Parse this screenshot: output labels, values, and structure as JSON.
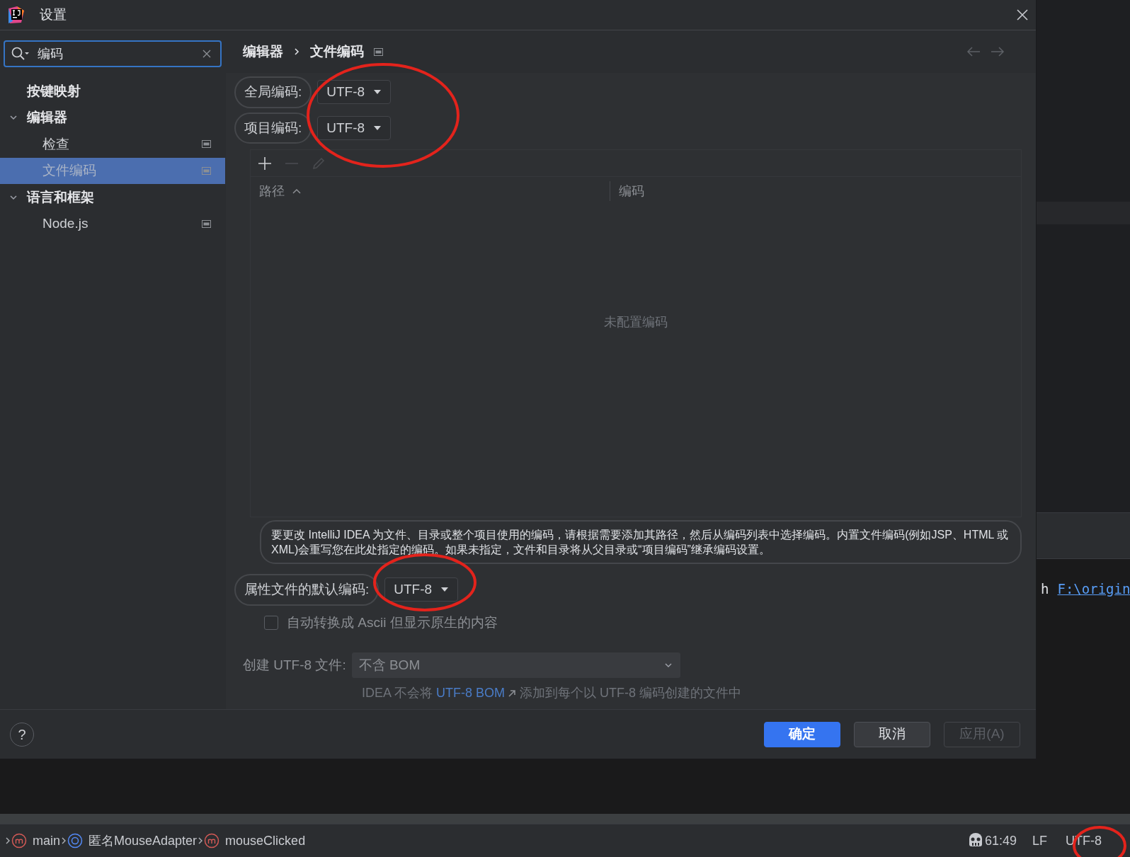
{
  "window": {
    "title": "设置"
  },
  "search": {
    "value": "编码"
  },
  "sidebar": {
    "items": [
      {
        "label": "按键映射",
        "selected": false
      },
      {
        "label": "编辑器",
        "selected": false,
        "expanded": true,
        "children": [
          {
            "label": "检查",
            "selected": false
          },
          {
            "label": "文件编码",
            "selected": true
          }
        ]
      },
      {
        "label": "语言和框架",
        "selected": false,
        "expanded": true,
        "children": [
          {
            "label": "Node.js",
            "selected": false
          }
        ]
      }
    ]
  },
  "breadcrumb": [
    "编辑器",
    "文件编码"
  ],
  "encoding_fields": [
    {
      "label": "全局编码:",
      "value": "UTF-8",
      "highlighted": true
    },
    {
      "label": "项目编码:",
      "value": "UTF-8",
      "highlighted": true
    }
  ],
  "table": {
    "toolbar": [
      {
        "kind": "add",
        "disabled": false
      },
      {
        "kind": "remove",
        "disabled": true
      },
      {
        "kind": "edit",
        "disabled": true
      }
    ],
    "columns": [
      {
        "label": "路径",
        "sorted": true
      },
      {
        "label": "编码",
        "sorted": false
      }
    ],
    "empty_text": "未配置编码"
  },
  "info_text": {
    "text": "要更改 IntelliJ IDEA 为文件、目录或整个项目使用的编码，请根据需要添加其路径，然后从编码列表中选择编码。内置文件编码(例如JSP、HTML 或 XML)会重写您在此处指定的编码。如果未指定，文件和目录将从父目录或“项目编码”继承编码设置。",
    "highlighted": true
  },
  "properties_field": {
    "label": "属性文件的默认编码:",
    "value": "UTF-8",
    "highlighted": true
  },
  "checkbox": {
    "label": "自动转换成 Ascii 但显示原生的内容",
    "checked": false
  },
  "bom_field": {
    "label": "创建 UTF-8 文件:",
    "value": "不含 BOM"
  },
  "bom_hint": {
    "before": "IDEA 不会将",
    "link": "UTF-8 BOM",
    "after": "添加到每个以 UTF-8 编码创建的文件中"
  },
  "buttons": [
    {
      "label": "确定",
      "kind": "primary"
    },
    {
      "label": "取消",
      "kind": "default"
    },
    {
      "label": "应用(A)",
      "kind": "disabled"
    }
  ],
  "help_button": "?",
  "editor": {
    "text": "h",
    "link": "F:\\origin"
  },
  "status_bar": {
    "breadcrumbs": [
      {
        "label": "main",
        "kind": "method"
      },
      {
        "label": "匿名MouseAdapter",
        "kind": "class"
      },
      {
        "label": "mouseClicked",
        "kind": "method"
      }
    ],
    "position": "61:49",
    "line_separator": "LF",
    "encoding": "UTF-8"
  }
}
